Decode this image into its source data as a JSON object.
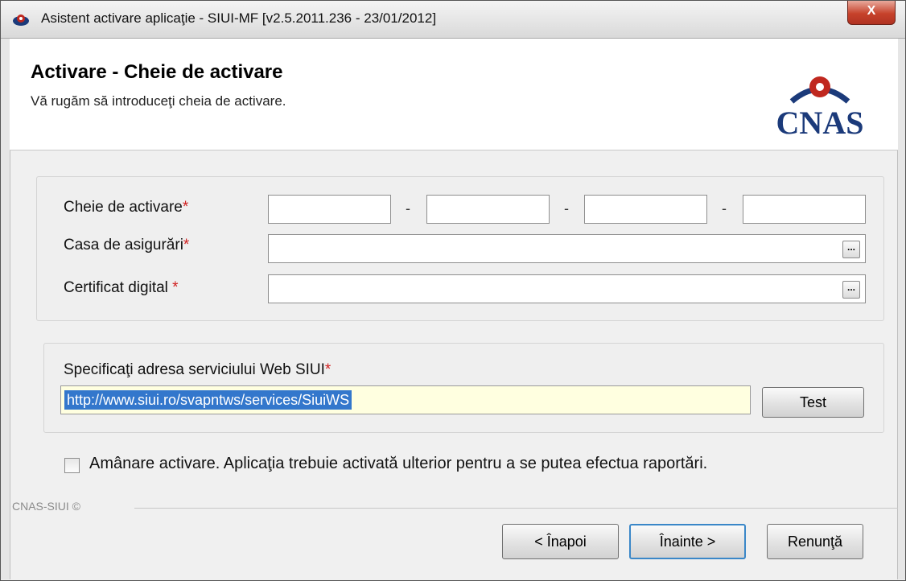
{
  "window": {
    "title": "Asistent activare aplicaţie - SIUI-MF [v2.5.2011.236 - 23/01/2012]",
    "close_label": "X"
  },
  "header": {
    "title": "Activare - Cheie de activare",
    "subtitle": "Vă rugăm să introduceţi cheia de activare.",
    "logo_text": "CNAS",
    "logo_color": "#1b3a7a",
    "logo_accent": "#c0281f"
  },
  "form": {
    "activation_key_label": "Cheie de activare",
    "insurance_house_label": "Casa de asigurări",
    "digital_certificate_label": "Certificat digital",
    "required_marker": "*",
    "key_separator": "-",
    "key_parts": [
      "",
      "",
      "",
      ""
    ],
    "insurance_house_value": "",
    "digital_certificate_value": "",
    "browse_label": "..."
  },
  "web_service": {
    "label": "Specificaţi adresa serviciului Web SIUI",
    "url": "http://www.siui.ro/svapntws/services/SiuiWS",
    "test_label": "Test"
  },
  "postpone": {
    "checked": false,
    "label": "Amânare activare. Aplicaţia trebuie activată ulterior pentru a se putea efectua raportări."
  },
  "footer": {
    "brand": "CNAS-SIUI ©",
    "back_label": "< Înapoi",
    "next_label": "Înainte >",
    "cancel_label": "Renunţă"
  }
}
